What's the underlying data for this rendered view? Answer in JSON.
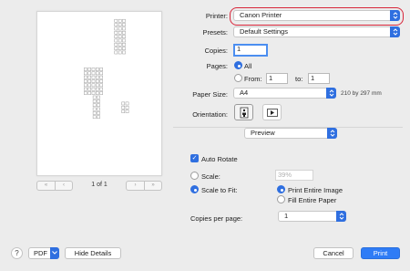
{
  "preview": {
    "page_counter": "1 of 1",
    "nav_first": "«",
    "nav_prev": "‹",
    "nav_next": "›",
    "nav_last": "»"
  },
  "printer": {
    "label": "Printer:",
    "value": "Canon Printer"
  },
  "presets": {
    "label": "Presets:",
    "value": "Default Settings"
  },
  "copies": {
    "label": "Copies:",
    "value": "1"
  },
  "pages": {
    "label": "Pages:",
    "all_label": "All",
    "from_label": "From:",
    "from_value": "1",
    "to_label": "to:",
    "to_value": "1",
    "selected": "all"
  },
  "paper_size": {
    "label": "Paper Size:",
    "value": "A4",
    "dimensions": "210 by 297 mm"
  },
  "orientation": {
    "label": "Orientation:",
    "selected": "portrait"
  },
  "section_popup": {
    "value": "Preview"
  },
  "auto_rotate": {
    "label": "Auto Rotate",
    "checked": true
  },
  "scale": {
    "label": "Scale:",
    "value": "39%",
    "selected": false
  },
  "scale_to_fit": {
    "label": "Scale to Fit:",
    "selected": true,
    "print_entire_image": "Print Entire Image",
    "fill_entire_paper": "Fill Entire Paper",
    "fit_choice": "print_entire_image"
  },
  "copies_per_page": {
    "label": "Copies per page:",
    "value": "1"
  },
  "footer": {
    "help": "?",
    "pdf": "PDF",
    "hide_details": "Hide Details",
    "cancel": "Cancel",
    "print": "Print"
  },
  "colors": {
    "accent": "#2f6fe0",
    "print_button": "#2f7cf6",
    "highlight_ring": "#d8263a"
  },
  "icons": {
    "popup_arrow": "up-down-chevron-icon",
    "orientation_portrait": "portrait-orientation-icon",
    "orientation_landscape": "landscape-orientation-icon",
    "check": "checkmark-icon"
  }
}
